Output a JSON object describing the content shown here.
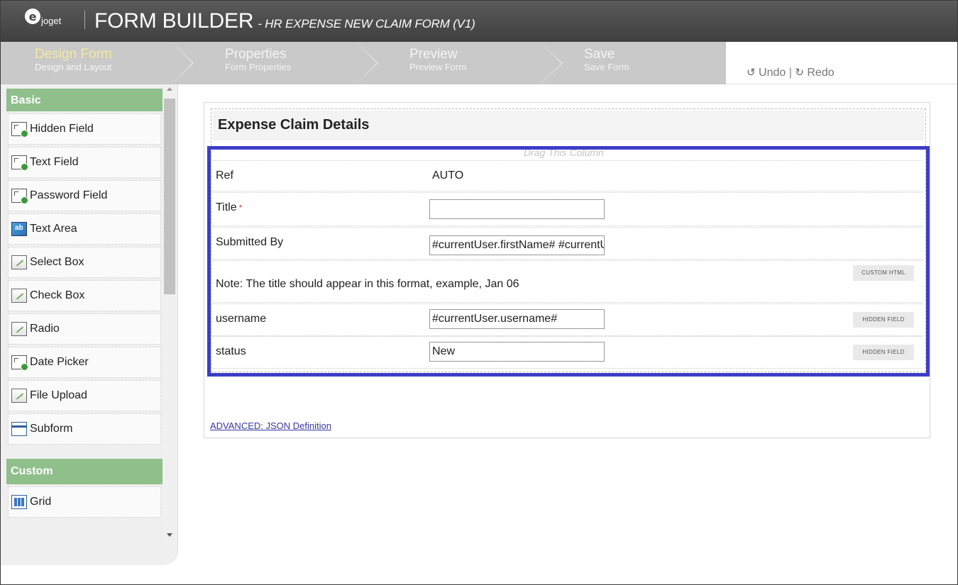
{
  "header": {
    "logo_text": "joget",
    "app_title": "FORM BUILDER",
    "form_subtitle": "- HR EXPENSE NEW CLAIM FORM (V1)"
  },
  "steps": [
    {
      "title": "Design Form",
      "subtitle": "Design and Layout",
      "active": true
    },
    {
      "title": "Properties",
      "subtitle": "Form Properties",
      "active": false
    },
    {
      "title": "Preview",
      "subtitle": "Preview Form",
      "active": false
    },
    {
      "title": "Save",
      "subtitle": "Save Form",
      "active": false
    }
  ],
  "toolbar": {
    "undo_label": "Undo",
    "redo_label": "Redo",
    "separator": "|"
  },
  "palette": {
    "basic_header": "Basic",
    "basic_items": [
      {
        "label": "Hidden Field",
        "icon": "field-icon"
      },
      {
        "label": "Text Field",
        "icon": "field-icon"
      },
      {
        "label": "Password Field",
        "icon": "field-icon"
      },
      {
        "label": "Text Area",
        "icon": "textarea-icon"
      },
      {
        "label": "Select Box",
        "icon": "edit-icon"
      },
      {
        "label": "Check Box",
        "icon": "edit-icon"
      },
      {
        "label": "Radio",
        "icon": "edit-icon"
      },
      {
        "label": "Date Picker",
        "icon": "field-icon"
      },
      {
        "label": "File Upload",
        "icon": "edit-icon"
      },
      {
        "label": "Subform",
        "icon": "subform-icon"
      }
    ],
    "custom_header": "Custom",
    "custom_items": [
      {
        "label": "Grid",
        "icon": "grid-icon"
      }
    ]
  },
  "form": {
    "section_title": "Expense Claim Details",
    "drag_hint": "Drag This Column",
    "rows": {
      "ref": {
        "label": "Ref",
        "value": "AUTO"
      },
      "title": {
        "label": "Title",
        "required_mark": "*",
        "value": ""
      },
      "submitted_by": {
        "label": "Submitted By",
        "value": "#currentUser.firstName# #currentUser.lastName#"
      },
      "note": {
        "text": "Note: The title should appear in this format, example, Jan 06",
        "badge": "CUSTOM HTML"
      },
      "username": {
        "label": "username",
        "value": "#currentUser.username#",
        "badge": "HIDDEN FIELD"
      },
      "status": {
        "label": "status",
        "value": "New",
        "badge": "HIDDEN FIELD"
      }
    },
    "json_link": "ADVANCED: JSON Definition"
  }
}
